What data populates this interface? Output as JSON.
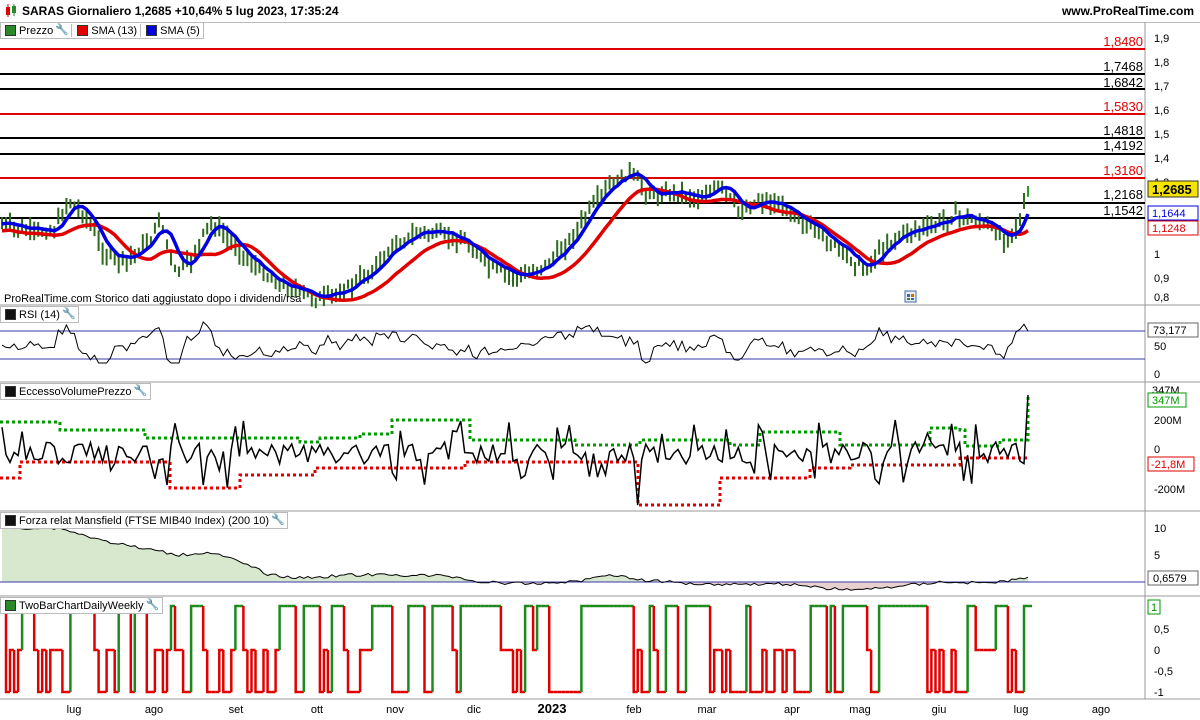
{
  "header": {
    "title": "SARAS Giornaliero 1,2685 +10,64% 5 lug 2023, 17:35:24",
    "site": "www.ProRealTime.com"
  },
  "price_panel": {
    "legend": [
      {
        "label": "Prezzo",
        "color": "#2a8a2a"
      },
      {
        "label": "SMA (13)",
        "color": "#e00000"
      },
      {
        "label": "SMA (5)",
        "color": "#0000e0"
      }
    ],
    "axis_ticks": [
      "1,9",
      "1,8",
      "1,7",
      "1,6",
      "1,5",
      "1,4",
      "1,3",
      "1",
      "0,9",
      "0,8"
    ],
    "levels": [
      {
        "label": "1,8480",
        "color": "#e00000"
      },
      {
        "label": "1,7468",
        "color": "#000000"
      },
      {
        "label": "1,6842",
        "color": "#000000"
      },
      {
        "label": "1,5830",
        "color": "#e00000"
      },
      {
        "label": "1,4818",
        "color": "#000000"
      },
      {
        "label": "1,4192",
        "color": "#000000"
      },
      {
        "label": "1,3180",
        "color": "#e00000"
      },
      {
        "label": "1,2168",
        "color": "#000000"
      },
      {
        "label": "1,1542",
        "color": "#000000"
      }
    ],
    "last_price": "1,2685",
    "sma5_value": "1,1644",
    "sma13_value": "1,1248",
    "note": "ProRealTime.com  Storico dati aggiustato dopo i dividendi/rsa"
  },
  "rsi_panel": {
    "legend": "RSI (14)",
    "axis_ticks": [
      "50",
      "0"
    ],
    "value": "73,177"
  },
  "volume_panel": {
    "legend": "EccessoVolumePrezzo",
    "axis_ticks": [
      "200M",
      "0",
      "-200M"
    ],
    "value_top": "347M",
    "value_green": "347M",
    "value_red": "-21,8M"
  },
  "mansfield_panel": {
    "legend": "Forza relat Mansfield (FTSE MIB40 Index) (200 10)",
    "axis_ticks": [
      "10",
      "5"
    ],
    "value": "0,6579"
  },
  "twobar_panel": {
    "legend": "TwoBarChartDailyWeekly",
    "axis_ticks": [
      "0,5",
      "0",
      "-0,5",
      "-1"
    ],
    "value": "1"
  },
  "x_axis": {
    "labels": [
      "lug",
      "ago",
      "set",
      "ott",
      "nov",
      "dic",
      "2023",
      "feb",
      "mar",
      "apr",
      "mag",
      "giu",
      "lug",
      "ago"
    ]
  },
  "colors": {
    "up": "#2a7a1a",
    "sma13": "#e00000",
    "sma5": "#0000e0",
    "level_red": "#e00000",
    "rsi_line": "#000000",
    "green_dots": "#009900",
    "red_dots": "#e00000",
    "mansfield_fill": "#c8e0c0"
  }
}
